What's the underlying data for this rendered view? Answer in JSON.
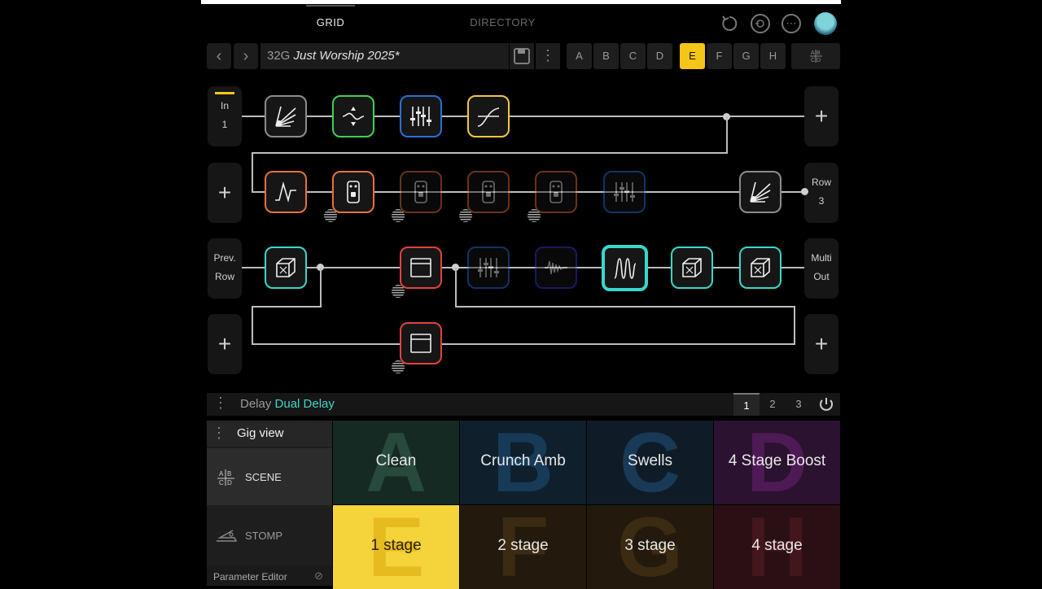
{
  "header": {
    "tabs": [
      {
        "label": "GRID"
      },
      {
        "label": "DIRECTORY"
      }
    ]
  },
  "preset": {
    "number": "32G",
    "name": "Just Worship 2025*",
    "scenes": [
      "A",
      "B",
      "C",
      "D",
      "E",
      "F",
      "G",
      "H"
    ],
    "active_scene": "E"
  },
  "grid": {
    "row1": {
      "in_label": "In",
      "in_num": "1"
    },
    "row2": {
      "out_label": "Row",
      "out_num": "3"
    },
    "row3": {
      "prev_label": "Prev.",
      "prev_sub": "Row",
      "out_label": "Multi",
      "out_sub": "Out"
    }
  },
  "param_bar": {
    "category": "Delay",
    "model": "Dual Delay",
    "pages": [
      "1",
      "2",
      "3"
    ],
    "active_page": "1"
  },
  "gig": {
    "title": "Gig view",
    "modes": [
      {
        "label": "SCENE"
      },
      {
        "label": "STOMP"
      }
    ],
    "parameter_editor": "Parameter Editor"
  },
  "scenes": [
    {
      "letter": "A",
      "name": "Clean",
      "bg": "#142a23",
      "letter_color": "#274a3d"
    },
    {
      "letter": "B",
      "name": "Crunch Amb",
      "bg": "#0f1f2c",
      "letter_color": "#173a57"
    },
    {
      "letter": "C",
      "name": "Swells",
      "bg": "#0f1c28",
      "letter_color": "#183a56"
    },
    {
      "letter": "D",
      "name": "4 Stage Boost",
      "bg": "#2b1230",
      "letter_color": "#4d1a55"
    },
    {
      "letter": "E",
      "name": "1 stage",
      "bg": "#f5d33a",
      "letter_color": "#e6bb1f"
    },
    {
      "letter": "F",
      "name": "2 stage",
      "bg": "#231a0d",
      "letter_color": "#3a2b12"
    },
    {
      "letter": "G",
      "name": "3 stage",
      "bg": "#231a0d",
      "letter_color": "#3a2b12"
    },
    {
      "letter": "H",
      "name": "4 stage",
      "bg": "#2a1014",
      "letter_color": "#43161c"
    }
  ],
  "colors": {
    "accent_yellow": "#f5c518",
    "model_cyan": "#3fd6c6",
    "gray": "#8c8c8c",
    "green": "#3ecf5a",
    "blue": "#2a6fd6",
    "yellow": "#f2c744",
    "orange": "#e8703a",
    "red": "#e2433d",
    "cyan": "#39d8c8",
    "navy": "#2d2d8f"
  }
}
